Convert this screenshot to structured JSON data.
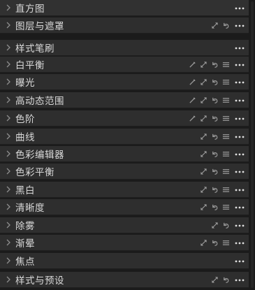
{
  "panels": [
    {
      "label": "直方图",
      "chevron": false,
      "tools": []
    },
    {
      "label": "图层与遮罩",
      "chevron": true,
      "tools": [
        "expand-arrow-icon",
        "reset-icon"
      ]
    },
    {
      "label": "样式笔刷",
      "chevron": true,
      "tools": []
    },
    {
      "label": "白平衡",
      "chevron": true,
      "tools": [
        "picker-icon",
        "expand-arrow-icon",
        "reset-icon",
        "list-icon"
      ]
    },
    {
      "label": "曝光",
      "chevron": true,
      "tools": [
        "picker-icon",
        "expand-arrow-icon",
        "reset-icon",
        "list-icon"
      ]
    },
    {
      "label": "高动态范围",
      "chevron": true,
      "tools": [
        "picker-icon",
        "expand-arrow-icon",
        "reset-icon",
        "list-icon"
      ]
    },
    {
      "label": "色阶",
      "chevron": true,
      "tools": [
        "picker-icon",
        "expand-arrow-icon",
        "reset-icon",
        "list-icon"
      ]
    },
    {
      "label": "曲线",
      "chevron": true,
      "tools": [
        "expand-arrow-icon",
        "reset-icon",
        "list-icon"
      ]
    },
    {
      "label": "色彩编辑器",
      "chevron": true,
      "tools": [
        "expand-arrow-icon",
        "reset-icon",
        "list-icon"
      ]
    },
    {
      "label": "色彩平衡",
      "chevron": true,
      "tools": [
        "expand-arrow-icon",
        "reset-icon",
        "list-icon"
      ]
    },
    {
      "label": "黑白",
      "chevron": true,
      "tools": [
        "expand-arrow-icon",
        "reset-icon",
        "list-icon"
      ]
    },
    {
      "label": "清晰度",
      "chevron": true,
      "tools": [
        "expand-arrow-icon",
        "reset-icon",
        "list-icon"
      ]
    },
    {
      "label": "除雾",
      "chevron": true,
      "tools": [
        "expand-arrow-icon",
        "reset-icon"
      ]
    },
    {
      "label": "渐晕",
      "chevron": true,
      "tools": [
        "expand-arrow-icon",
        "reset-icon",
        "list-icon"
      ]
    },
    {
      "label": "焦点",
      "chevron": true,
      "tools": []
    },
    {
      "label": "样式与预设",
      "chevron": true,
      "tools": [
        "expand-arrow-icon",
        "reset-icon"
      ]
    }
  ],
  "colors": {
    "background": "#1b1b1b",
    "row": "#2e2e2e",
    "text": "#d9d9d9",
    "icon": "#9a9a9a",
    "more_icon": "#e0e0e0"
  }
}
